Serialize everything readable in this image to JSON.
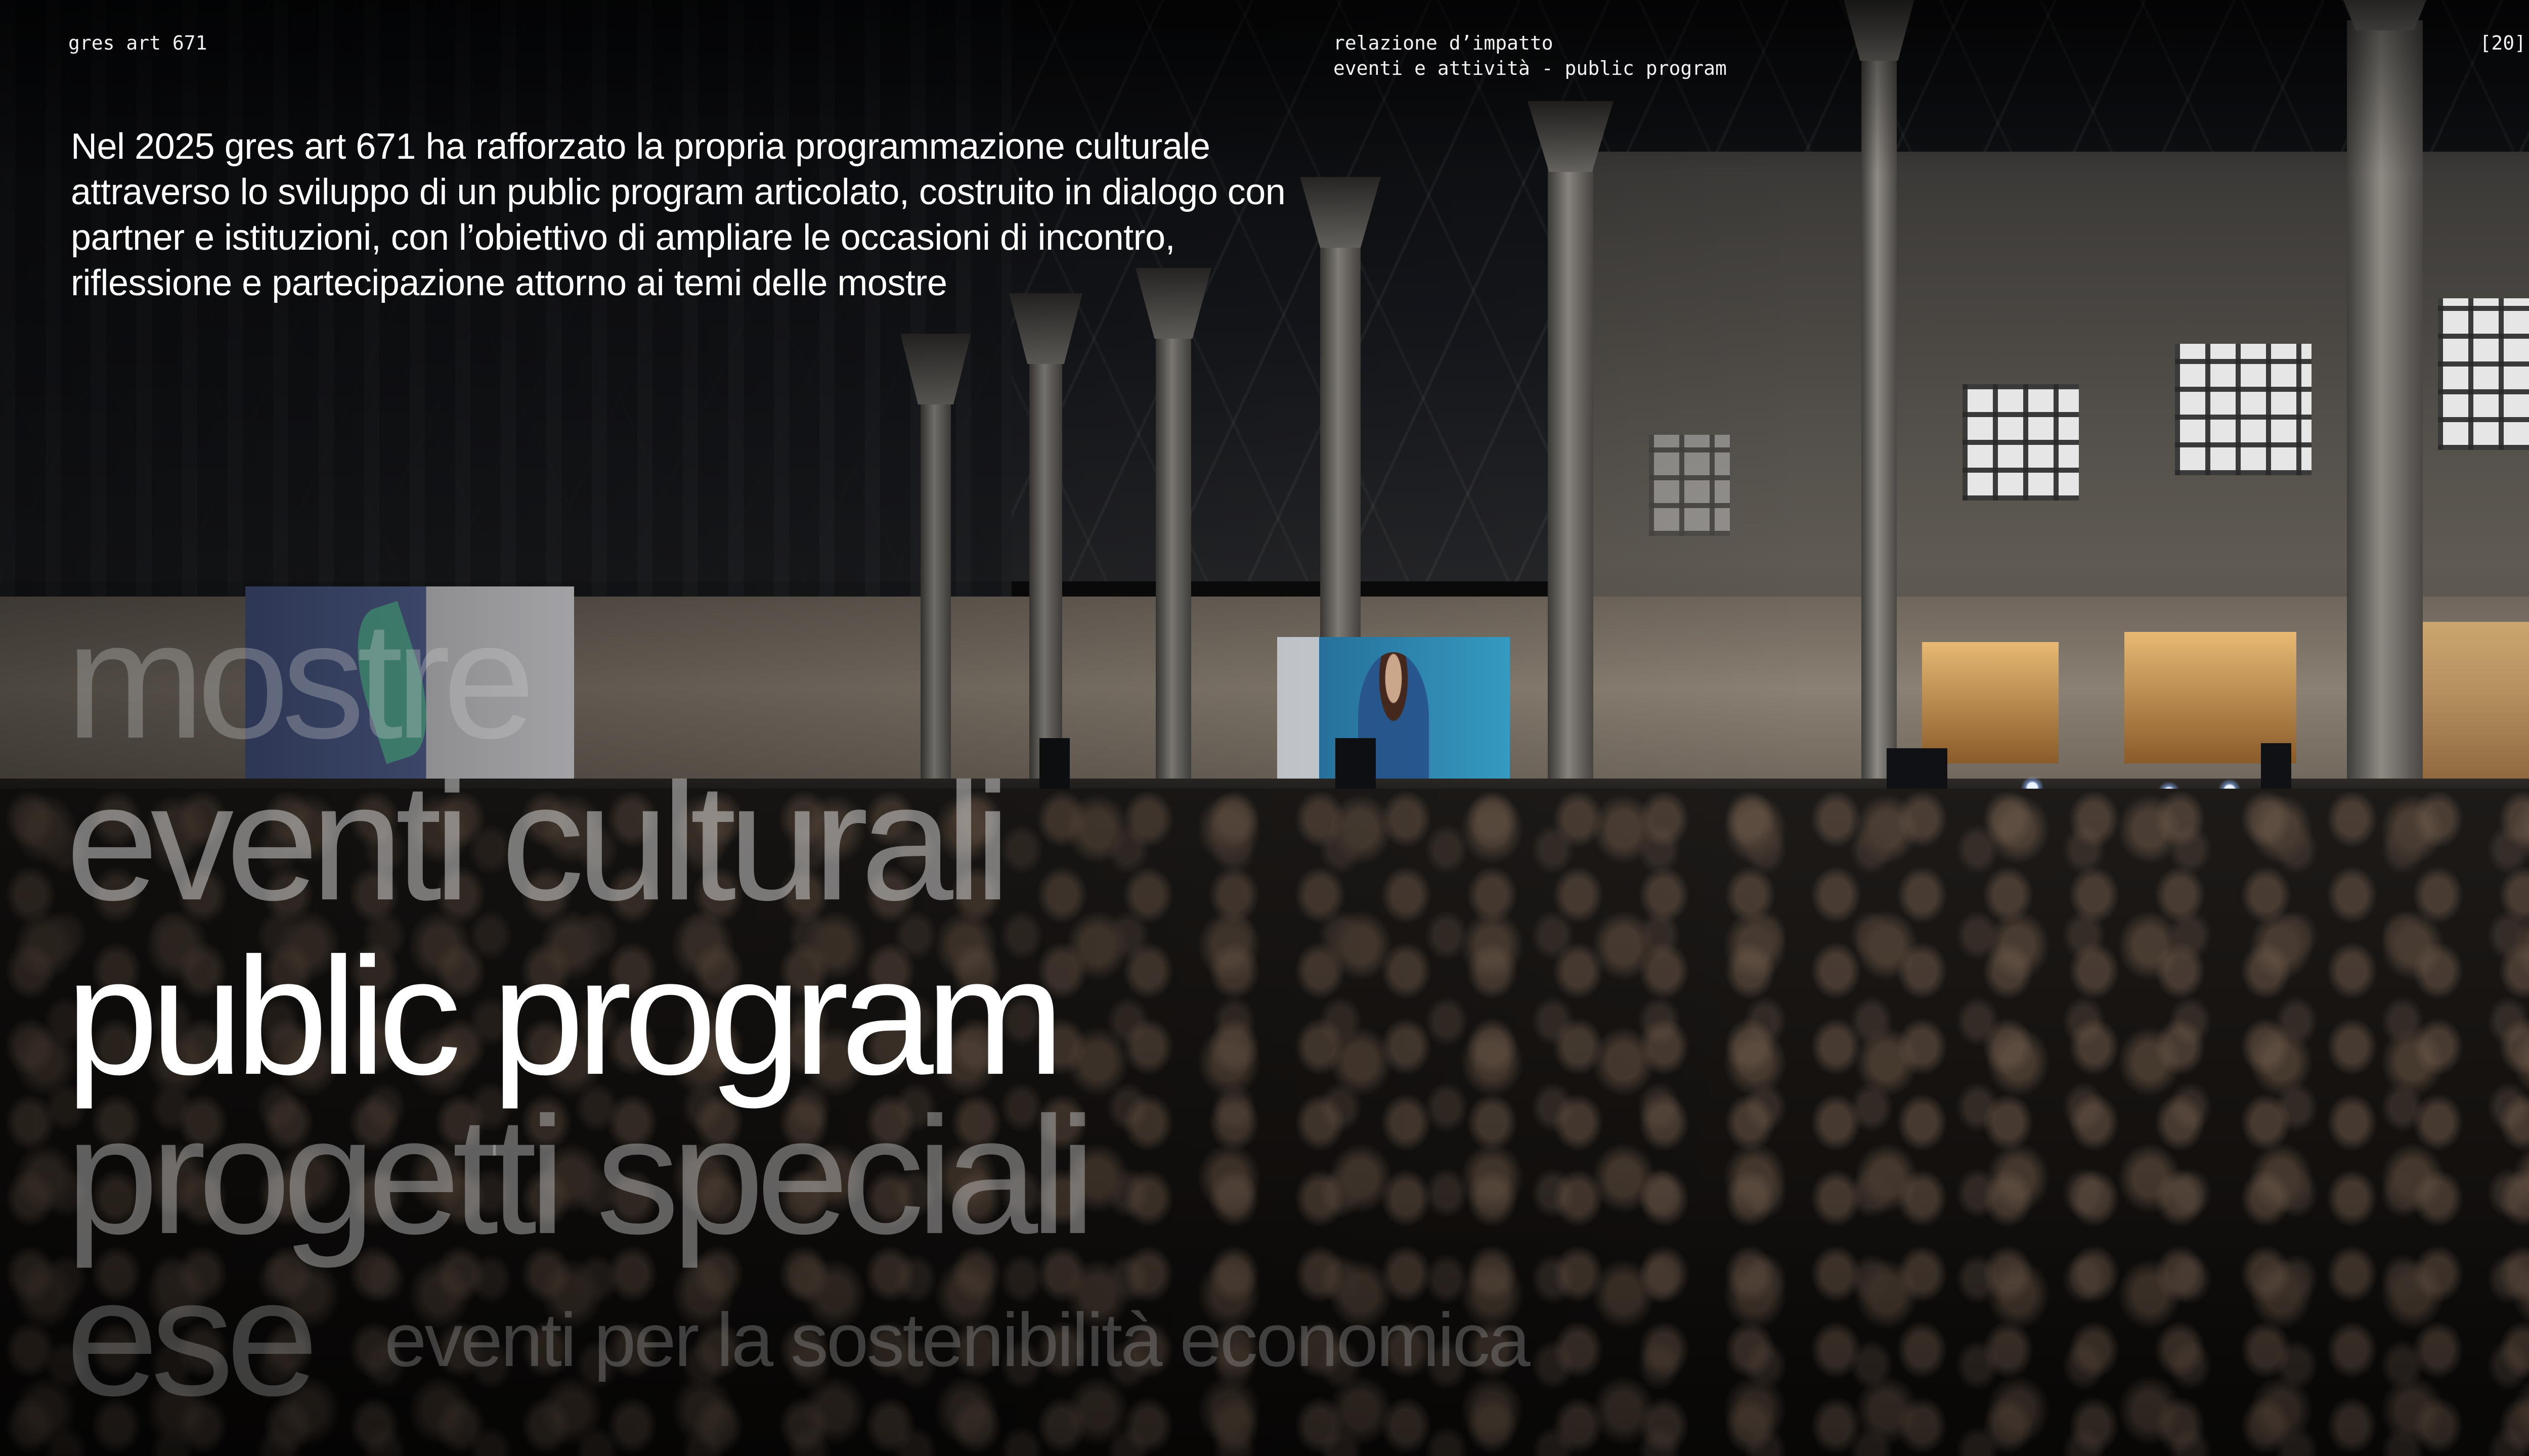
{
  "header": {
    "brand": "gres art 671",
    "section_line1": "relazione d’impatto",
    "section_line2": "eventi e attività - public program",
    "page_number": "[20]"
  },
  "intro": {
    "text": "Nel 2025 gres art 671 ha rafforzato la propria programmazione culturale attraverso lo sviluppo di un public program articolato, costruito in dialogo con partner e istituzioni, con l’obiettivo di ampliare le occasioni di incontro, riflessione e partecipazione attorno ai temi delle mostre"
  },
  "sections": {
    "mostre": "mostre",
    "eventi_culturali": "eventi culturali",
    "public_program": "public program",
    "progetti_speciali": "progetti speciali",
    "ese": "ese",
    "ese_description": "eventi per la sostenibilità economica"
  },
  "colors": {
    "background": "#0b0b0c",
    "text_primary": "#ffffff"
  }
}
